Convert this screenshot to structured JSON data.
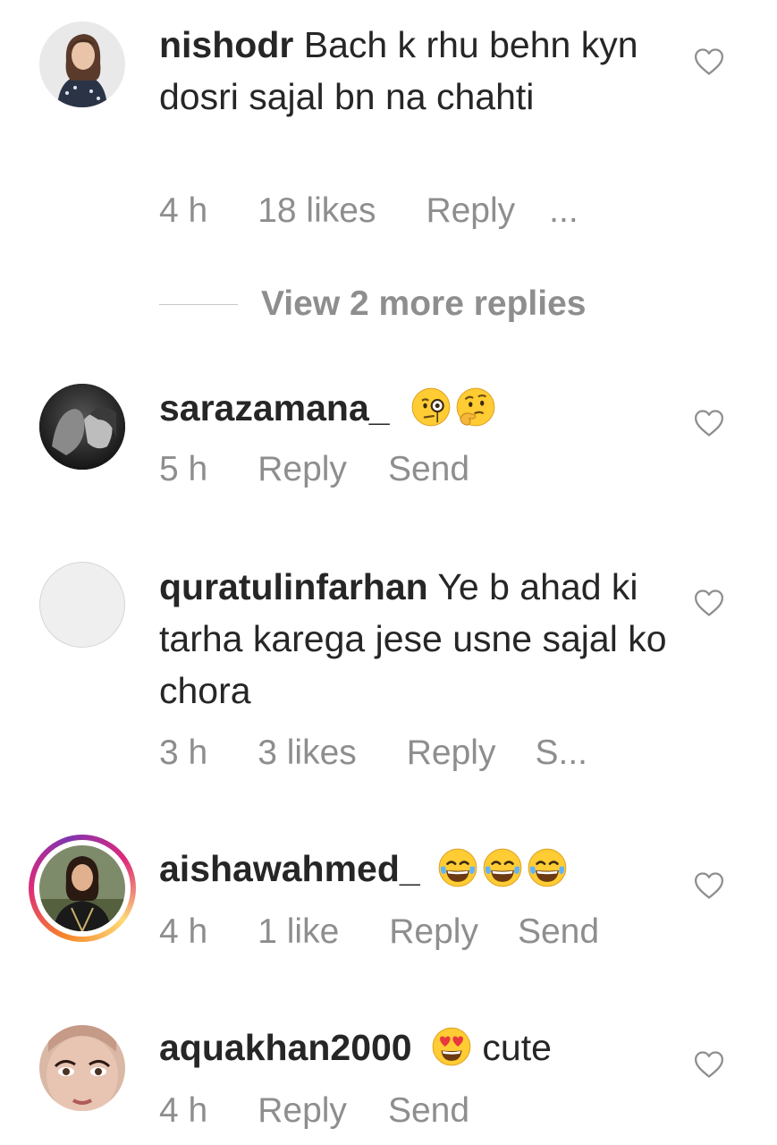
{
  "comments": [
    {
      "username": "nishodr",
      "text": " Bach k rhu behn kyn dosri sajal bn na chahti",
      "time": "4 h",
      "likes": "18 likes",
      "reply": "Reply",
      "extra": "...",
      "avatar": "woman-portrait-avatar"
    },
    {
      "username": "sarazamana_",
      "text": "",
      "emojis": [
        "face-with-monocle-emoji",
        "thinking-face-emoji"
      ],
      "time": "5 h",
      "reply": "Reply",
      "send": "Send",
      "avatar": "couple-photo-avatar"
    },
    {
      "username": "quratulinfarhan",
      "text": " Ye b ahad ki tarha karega jese usne sajal ko chora",
      "time": "3 h",
      "likes": "3 likes",
      "reply": "Reply",
      "send": "S...",
      "avatar": "blank-avatar"
    },
    {
      "username": "aishawahmed_",
      "text": "",
      "emojis": [
        "tears-of-joy-emoji",
        "tears-of-joy-emoji",
        "tears-of-joy-emoji"
      ],
      "time": "4 h",
      "likes": "1 like",
      "reply": "Reply",
      "send": "Send",
      "avatar": "woman-story-avatar"
    },
    {
      "username": "aquakhan2000",
      "text": " cute",
      "emojis": [
        "heart-eyes-emoji"
      ],
      "time": "4 h",
      "reply": "Reply",
      "send": "Send",
      "avatar": "woman-face-avatar"
    }
  ],
  "view_replies": "View 2 more replies",
  "colors": {
    "text": "#262626",
    "secondary": "#8e8e8e",
    "story_ring_start": "#f58529",
    "story_ring_end": "#dd2a7b"
  }
}
